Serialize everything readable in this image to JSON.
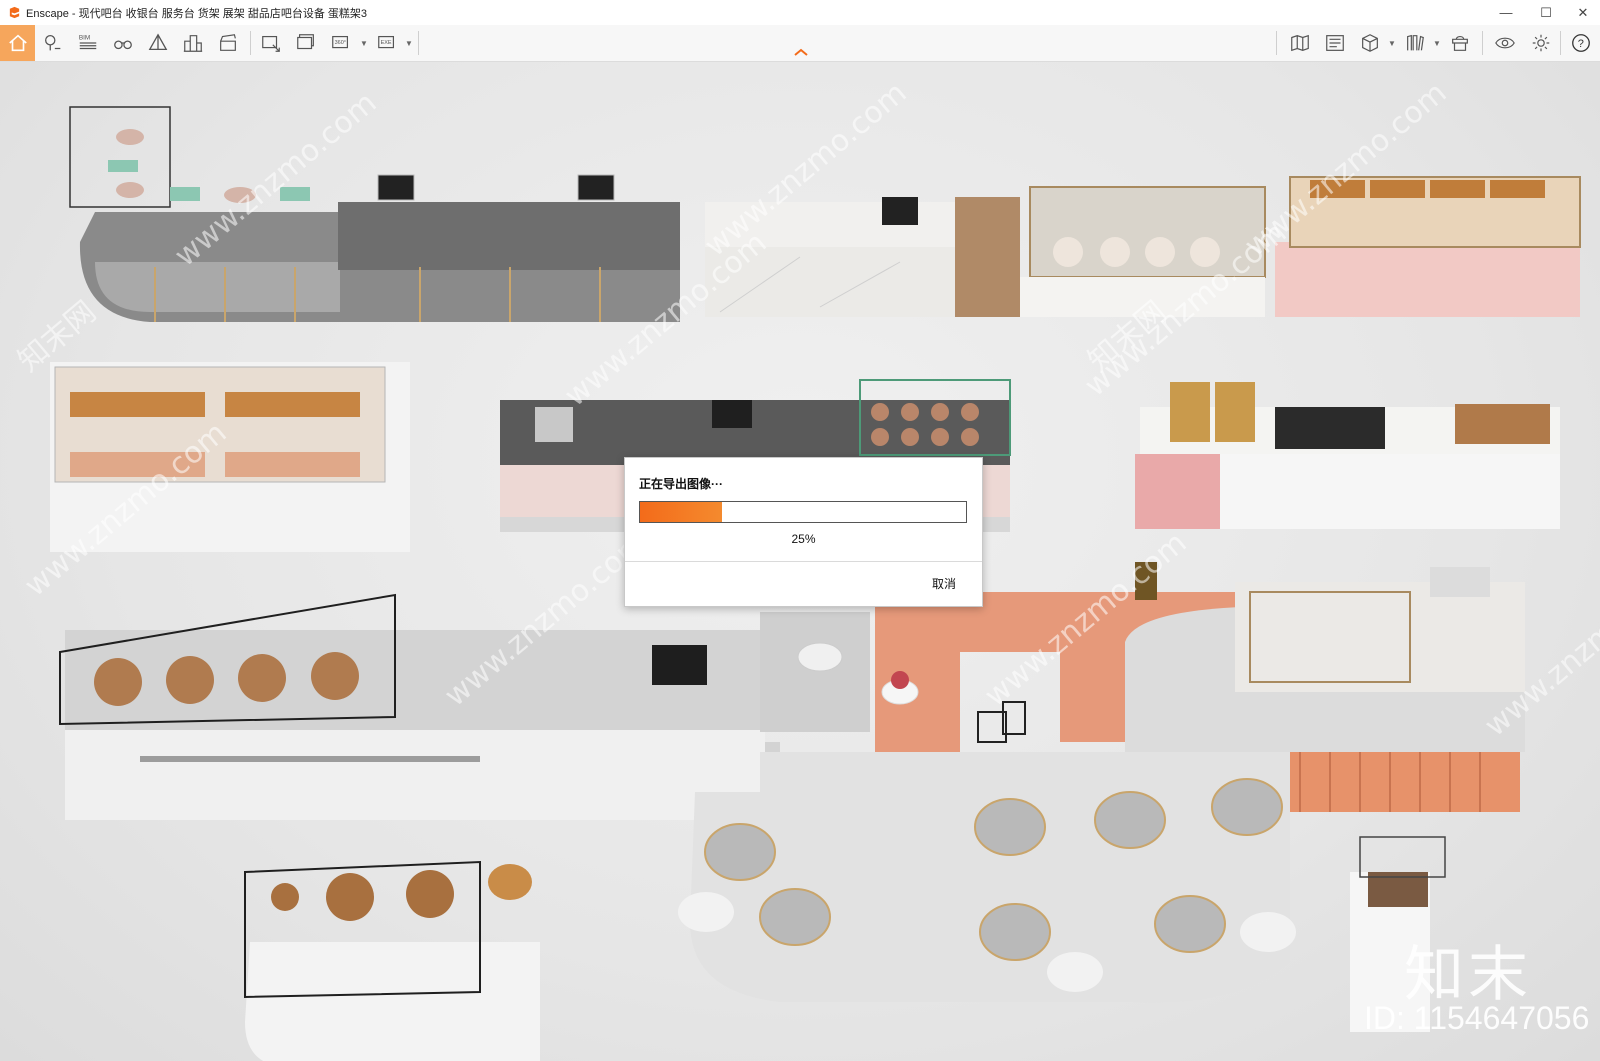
{
  "window": {
    "app_name": "Enscape",
    "title": "Enscape - 现代吧台 收银台 服务台 货架 展架 甜品店吧台设备 蛋糕架3",
    "controls": {
      "minimize": "—",
      "maximize": "☐",
      "close": "✕"
    }
  },
  "toolbar": {
    "left_icons": [
      "home-icon",
      "location-pin-icon",
      "bim-icon",
      "binoculars-icon",
      "perspective-icon",
      "buildings-icon",
      "clapperboard-icon",
      "screenshot-export-icon",
      "batch-render-icon",
      "panorama-360-icon",
      "exe-export-icon"
    ],
    "bim_label": "BIM",
    "panorama_label": "360°",
    "exe_label": "EXE",
    "right_icons": [
      "map-icon",
      "material-editor-icon",
      "cube-icon",
      "books-icon",
      "asset-library-icon",
      "eye-icon",
      "gear-icon",
      "help-icon"
    ],
    "home_color": "#f6a65c"
  },
  "dialog": {
    "title": "正在导出图像···",
    "progress_percent": 25,
    "progress_text": "25%",
    "cancel_label": "取消",
    "progress_color": "#f36b1a"
  },
  "watermarks": {
    "site": "www.znzmo.com",
    "brand_cn": "知末网",
    "logo_text": "知末",
    "id_text": "ID: 1154647056"
  }
}
